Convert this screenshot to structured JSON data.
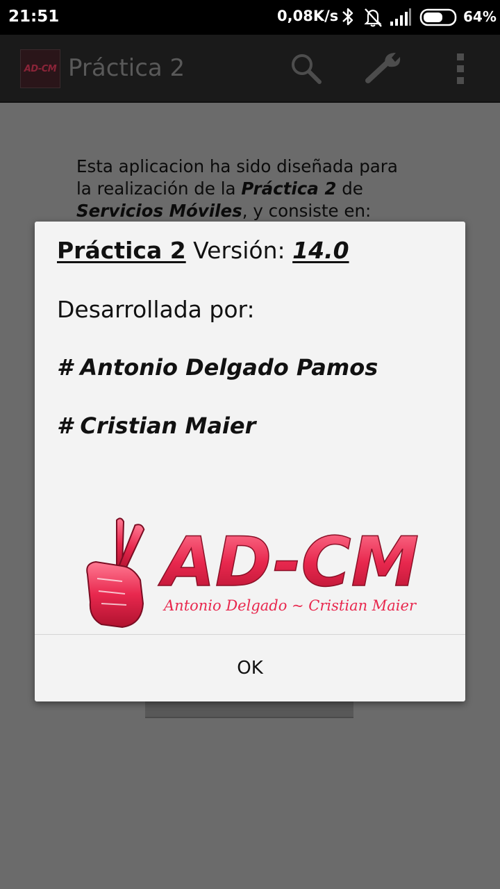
{
  "status_bar": {
    "time": "21:51",
    "net_speed": "0,08K/s",
    "battery_percent": "64%",
    "battery_level": 0.64,
    "icons": [
      "bluetooth-icon",
      "bell-muted-icon",
      "signal-icon",
      "battery-icon"
    ]
  },
  "action_bar": {
    "logo_text": "AD-CM",
    "title": "Práctica 2",
    "icons": [
      "search-icon",
      "wrench-icon",
      "overflow-menu-icon"
    ]
  },
  "background": {
    "intro": {
      "line1": "Esta aplicacion ha sido diseñada para",
      "line2_prefix": "la realización de la ",
      "line2_bold": "Práctica 2",
      "line2_suffix": " de",
      "line3_bold": "Servicios Móviles",
      "line3_suffix": ", y consiste en:"
    }
  },
  "dialog": {
    "practice_label": "Práctica 2",
    "version_label": " Versión: ",
    "version_value": "14.0",
    "developed_by": "Desarrollada por:",
    "author1": "# Antonio Delgado Pamos",
    "author2": "# Cristian Maier",
    "logo": {
      "title": "AD-CM",
      "subtitle": "Antonio Delgado ~ Cristian Maier"
    },
    "ok_label": "OK"
  },
  "colors": {
    "logo_red": "#e8284e",
    "scrim": "#6b6b6b",
    "dialog_bg": "#f3f3f3",
    "status_bar": "#000000"
  }
}
